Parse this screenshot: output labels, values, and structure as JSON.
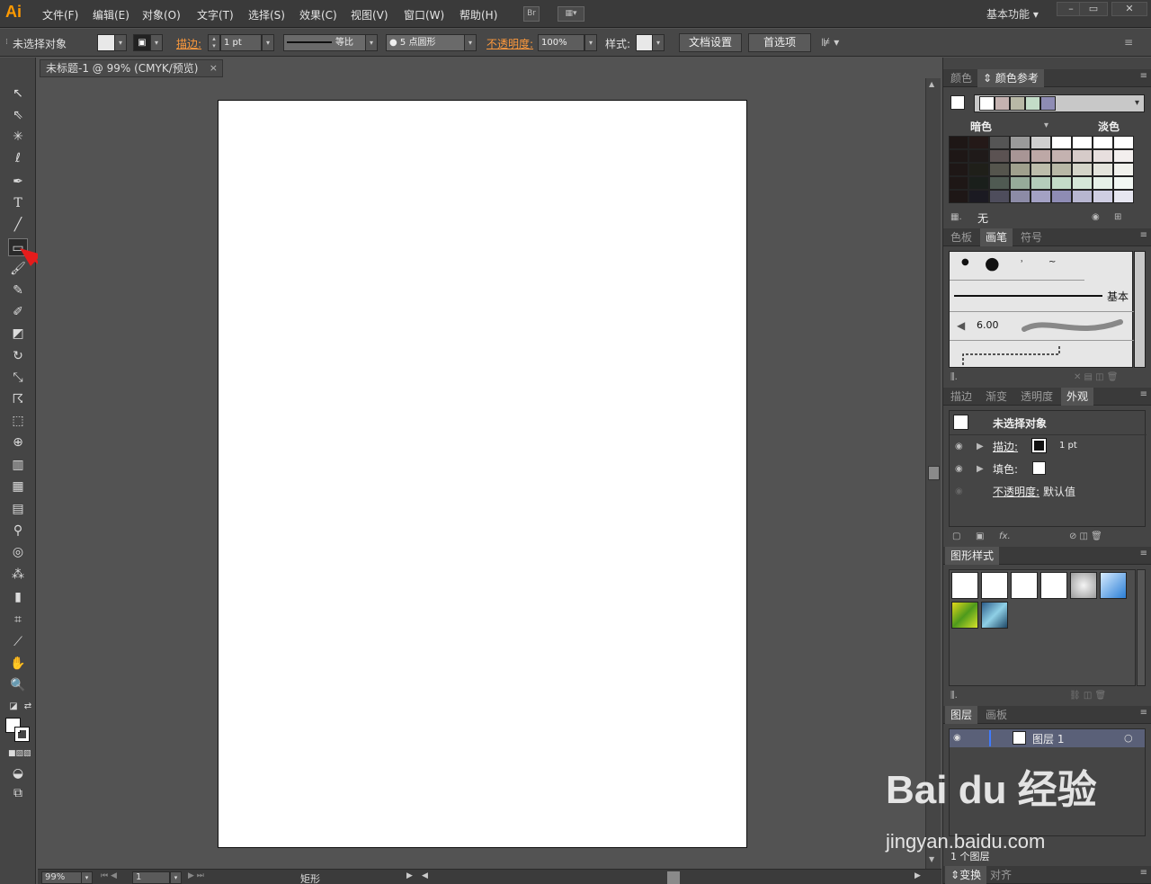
{
  "app": {
    "logo": "Ai",
    "menu": [
      "文件(F)",
      "编辑(E)",
      "对象(O)",
      "文字(T)",
      "选择(S)",
      "效果(C)",
      "视图(V)",
      "窗口(W)",
      "帮助(H)"
    ],
    "bridge_label": "Br",
    "workspace": "基本功能"
  },
  "control_bar": {
    "selection_status": "未选择对象",
    "stroke_label": "描边:",
    "stroke_weight": "1 pt",
    "stroke_profile": "等比",
    "brush": "5 点圆形",
    "opacity_label": "不透明度:",
    "opacity_value": "100%",
    "style_label": "样式:",
    "doc_setup_button": "文档设置",
    "preferences_button": "首选项"
  },
  "document": {
    "tab_title": "未标题-1 @ 99% (CMYK/预览)",
    "close_glyph": "×",
    "zoom": "99%",
    "artboard_number": "1",
    "status_tool": "矩形"
  },
  "panels": {
    "color_tabs": [
      "颜色",
      "颜色参考"
    ],
    "guide_left_label": "暗色",
    "guide_right_label": "淡色",
    "guide_none_label": "无",
    "harmony_colors": [
      "#ffffff",
      "#c4b2b0",
      "#b8b8a6",
      "#c3dcc8",
      "#8e8cb4"
    ],
    "guide_columns": [
      [
        "#241918",
        "#1f1a19",
        "#1f1f19",
        "#1a1f1b",
        "#1b1a22"
      ],
      [
        "#555555",
        "#5b5252",
        "#55554d",
        "#4f5a52",
        "#4e4d5c"
      ],
      [
        "#9a9a9a",
        "#a89595",
        "#a0a08d",
        "#96ab9a",
        "#8c8ba6"
      ],
      [
        "#cfcfcf",
        "#bda8a6",
        "#bdbdab",
        "#b4ccba",
        "#a3a1c3"
      ],
      [
        "#ffffff",
        "#c4b2b0",
        "#b8b8a6",
        "#c3dcc8",
        "#8e8cb4"
      ],
      [
        "#ffffff",
        "#d6cbc9",
        "#d4d4c8",
        "#d5e7d8",
        "#b7b6d0"
      ],
      [
        "#ffffff",
        "#e7dfde",
        "#e4e4dc",
        "#e6f1e8",
        "#cfcee2"
      ],
      [
        "#ffffff",
        "#f3efee",
        "#f1f1ec",
        "#f2f8f3",
        "#e6e6f0"
      ]
    ],
    "brush_tabs": [
      "色板",
      "画笔",
      "符号"
    ],
    "brush_basic_label": "基本",
    "brush_size": "6.00",
    "appearance_tabs": [
      "描边",
      "渐变",
      "透明度",
      "外观"
    ],
    "appearance_title": "未选择对象",
    "appearance_rows": [
      {
        "label": "描边:",
        "value": "1 pt"
      },
      {
        "label": "填色:",
        "value": ""
      },
      {
        "label": "不透明度:",
        "value": "默认值"
      }
    ],
    "graphic_styles_tab": "图形样式",
    "layers_tabs": [
      "图层",
      "画板"
    ],
    "layer_name": "图层 1",
    "layer_count": "1 个图层",
    "bottom_tabs": [
      "变换",
      "对齐"
    ],
    "fx_label": "fx."
  },
  "watermark": {
    "brand": "Bai du 经验",
    "url": "jingyan.baidu.com"
  }
}
